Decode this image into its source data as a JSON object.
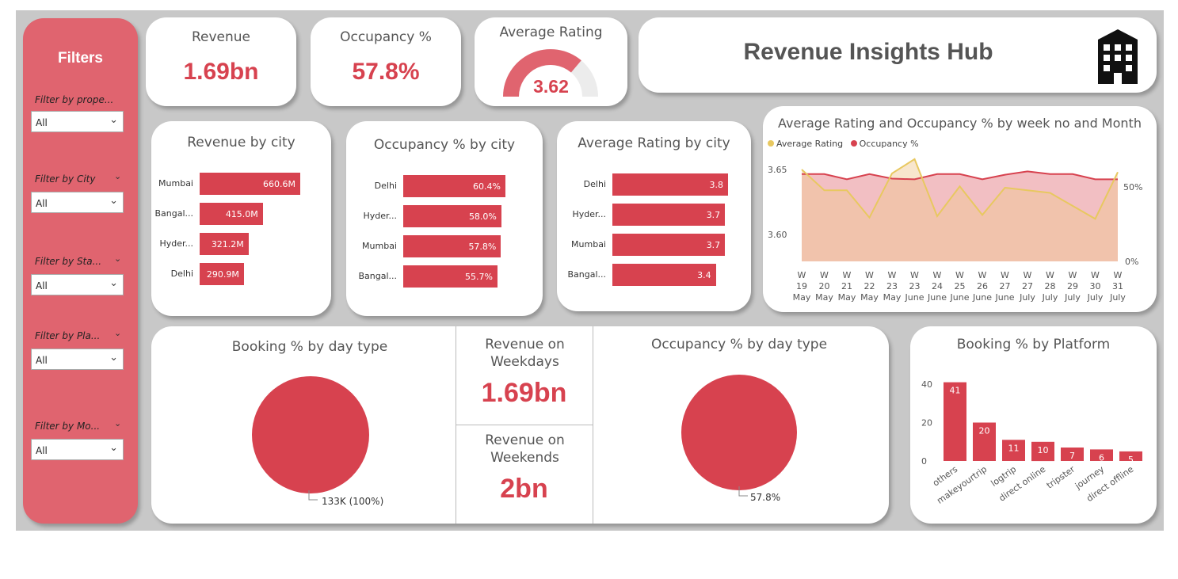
{
  "filters": {
    "title": "Filters",
    "items": [
      {
        "label": "Filter by prope...",
        "value": "All"
      },
      {
        "label": "Filter by City",
        "value": "All"
      },
      {
        "label": "Filter by Sta...",
        "value": "All"
      },
      {
        "label": "Filter by Pla...",
        "value": "All"
      },
      {
        "label": "Filter by Mo...",
        "value": "All"
      }
    ]
  },
  "kpis": {
    "revenue": {
      "label": "Revenue",
      "value": "1.69bn"
    },
    "occupancy": {
      "label": "Occupancy %",
      "value": "57.8%"
    },
    "rating": {
      "label": "Average Rating",
      "value": "3.62",
      "gauge_fraction": 0.724
    }
  },
  "header": {
    "title": "Revenue Insights Hub",
    "icon": "hotel-building-icon"
  },
  "colors": {
    "accent": "#d7424f",
    "filter_bg": "#e0646f",
    "line_rating": "#e8c860",
    "area_occ": "#f0b4b8"
  },
  "revenue_by_city": {
    "title": "Revenue by city",
    "chart_data": {
      "type": "bar",
      "orientation": "horizontal",
      "categories": [
        "Mumbai",
        "Bangal...",
        "Hyder...",
        "Delhi"
      ],
      "values": [
        660.6,
        415.0,
        321.2,
        290.9
      ],
      "labels": [
        "660.6M",
        "415.0M",
        "321.2M",
        "290.9M"
      ]
    }
  },
  "occupancy_by_city": {
    "title": "Occupancy % by city",
    "chart_data": {
      "type": "bar",
      "orientation": "horizontal",
      "categories": [
        "Delhi",
        "Hyder...",
        "Mumbai",
        "Bangal..."
      ],
      "values": [
        60.4,
        58.0,
        57.8,
        55.7
      ],
      "labels": [
        "60.4%",
        "58.0%",
        "57.8%",
        "55.7%"
      ]
    }
  },
  "rating_by_city": {
    "title": "Average Rating by city",
    "chart_data": {
      "type": "bar",
      "orientation": "horizontal",
      "categories": [
        "Delhi",
        "Hyder...",
        "Mumbai",
        "Bangal..."
      ],
      "values": [
        3.8,
        3.7,
        3.7,
        3.4
      ],
      "labels": [
        "3.8",
        "3.7",
        "3.7",
        "3.4"
      ]
    }
  },
  "trend": {
    "title": "Average Rating and Occupancy % by week no and Month",
    "chart_data": {
      "type": "area",
      "x_weeks": [
        "W 19",
        "W 20",
        "W 21",
        "W 22",
        "W 23",
        "W 23",
        "W 24",
        "W 25",
        "W 26",
        "W 27",
        "W 27",
        "W 28",
        "W 29",
        "W 30",
        "W 31"
      ],
      "x_months": [
        "May",
        "May",
        "May",
        "May",
        "May",
        "June",
        "June",
        "June",
        "June",
        "June",
        "July",
        "July",
        "July",
        "July",
        "July"
      ],
      "series": [
        {
          "name": "Average Rating",
          "values": [
            3.65,
            3.634,
            3.634,
            3.613,
            3.647,
            3.658,
            3.614,
            3.637,
            3.615,
            3.636,
            3.634,
            3.632,
            3.622,
            3.612,
            3.648
          ]
        },
        {
          "name": "Occupancy %",
          "values": [
            58.6,
            58.6,
            55.1,
            58.6,
            55.6,
            55.1,
            58.6,
            58.6,
            55.1,
            58.2,
            60.4,
            58.6,
            58.6,
            55.1,
            55.1
          ]
        }
      ],
      "y_left_ticks": [
        "3.65",
        "3.60"
      ],
      "y_right_ticks": [
        "50%",
        "0%"
      ],
      "legend_position": "top-left"
    }
  },
  "booking_day_type": {
    "title": "Booking % by day type",
    "chart_data": {
      "type": "pie",
      "values": [
        100
      ],
      "label": "133K (100%)"
    }
  },
  "revenue_weekdays": {
    "label": "Revenue on Weekdays",
    "value": "1.69bn"
  },
  "revenue_weekends": {
    "label": "Revenue on Weekends",
    "value": "2bn"
  },
  "occupancy_day_type": {
    "title": "Occupancy % by day type",
    "chart_data": {
      "type": "pie",
      "values": [
        57.8
      ],
      "label": "57.8%"
    }
  },
  "booking_platform": {
    "title": "Booking % by Platform",
    "chart_data": {
      "type": "bar",
      "categories": [
        "others",
        "makeyourtrip",
        "logtrip",
        "direct online",
        "tripster",
        "journey",
        "direct offline"
      ],
      "values": [
        41,
        20,
        11,
        10,
        7,
        6,
        5
      ],
      "y_ticks": [
        "40",
        "20",
        "0"
      ]
    }
  }
}
